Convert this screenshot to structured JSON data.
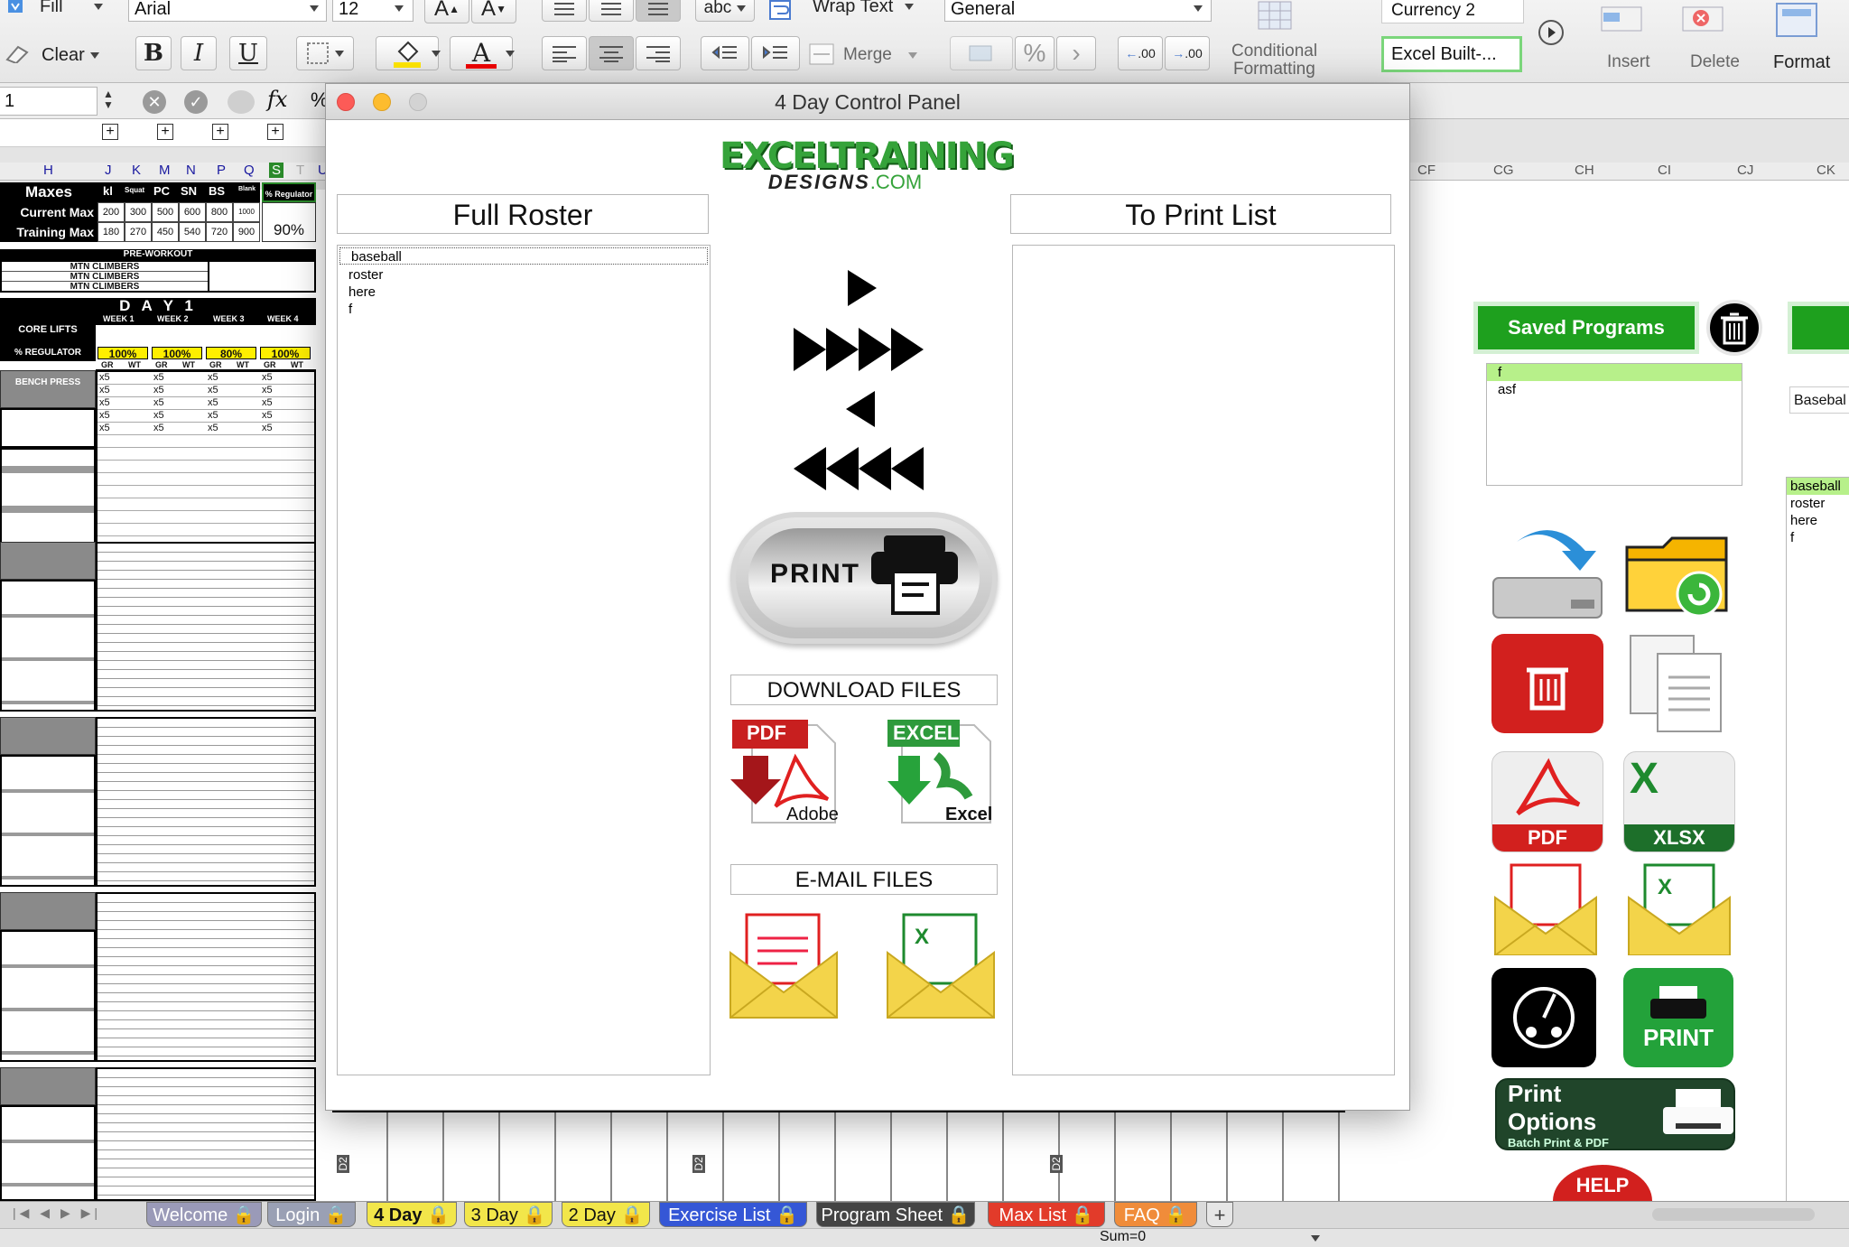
{
  "ribbon": {
    "fill_label": "Fill",
    "clear_label": "Clear",
    "font_name": "Arial",
    "font_size": "12",
    "wrap_text_label": "Wrap Text",
    "merge_label": "Merge",
    "number_format": "General",
    "conditional_label_1": "Conditional",
    "conditional_label_2": "Formatting",
    "style_1": "Currency 2",
    "style_2": "Excel Built-...",
    "insert_label": "Insert",
    "delete_label": "Delete",
    "format_label": "Format",
    "abc_label": "abc",
    "bold": "B",
    "italic": "I",
    "underline": "U",
    "font_color_letter": "A",
    "grow_font": "A",
    "shrink_font": "A",
    "percent": "%",
    "decimal_inc": ".00",
    "decimal_dec": ".00"
  },
  "formula_bar": {
    "name_box": "1",
    "fx": "fx",
    "percent_char": "%"
  },
  "sheet": {
    "columns": [
      "H",
      "J",
      "K",
      "M",
      "N",
      "P",
      "Q",
      "S",
      "T",
      "U"
    ],
    "right_columns": [
      "CF",
      "CG",
      "CH",
      "CI",
      "CJ",
      "CK"
    ],
    "maxes_label": "Maxes",
    "current_max_label": "Current Max",
    "training_max_label": "Training Max",
    "lift_headers": [
      "kl",
      "Squat",
      "PC",
      "SN",
      "BS",
      "Blank",
      "% Regulator"
    ],
    "current_values": [
      "200",
      "300",
      "500",
      "600",
      "800",
      "1000"
    ],
    "training_values": [
      "180",
      "270",
      "450",
      "540",
      "720",
      "900"
    ],
    "regulator_value": "90%",
    "preworkout_label": "PRE-WORKOUT",
    "mtn_climbers": [
      "MTN CLIMBERS",
      "MTN CLIMBERS",
      "MTN CLIMBERS"
    ],
    "day_label": "D A Y   1",
    "weeks": [
      "WEEK 1",
      "WEEK 2",
      "WEEK 3",
      "WEEK 4"
    ],
    "core_lifts_label": "CORE LIFTS",
    "pct_regulator_label": "% REGULATOR",
    "week_pcts": [
      "100%",
      "100%",
      "80%",
      "100%"
    ],
    "gr_wt": [
      "GR",
      "WT"
    ],
    "bench_press_label": "BENCH PRESS",
    "rep_mark": "x5",
    "d2_label": "D2"
  },
  "dialog": {
    "title": "4 Day Control Panel",
    "logo_main": "EXCELTRAINING",
    "logo_sub": "DESIGNS",
    "logo_dotcom": ".COM",
    "full_roster_label": "Full Roster",
    "to_print_label": "To Print List",
    "roster_items": [
      "baseball",
      "roster",
      "here",
      "f"
    ],
    "print_label": "PRINT",
    "download_label": "DOWNLOAD FILES",
    "email_label": "E-MAIL FILES",
    "pdf_badge": "PDF",
    "adobe_label": "Adobe",
    "excel_badge": "EXCEL",
    "excel_label": "Excel"
  },
  "right_panel": {
    "saved_programs_label": "Saved Programs",
    "saved_items": [
      "f",
      "asf"
    ],
    "baseball_partial": "Basebal",
    "side_list": [
      "baseball",
      "roster",
      "here",
      "f"
    ],
    "pdf_tile": "PDF",
    "xlsx_tile": "XLSX",
    "print_tile": "PRINT",
    "print_options_title": "Print Options",
    "print_options_sub": "Batch Print & PDF",
    "help_label": "HELP"
  },
  "tabs": [
    {
      "label": "Welcome",
      "color": "#9a9ab8"
    },
    {
      "label": "Login",
      "color": "#9aa0b4"
    },
    {
      "label": "4 Day",
      "color": "#f2e64a"
    },
    {
      "label": "3 Day",
      "color": "#f2e64a"
    },
    {
      "label": "2 Day",
      "color": "#f2e64a"
    },
    {
      "label": "Exercise List",
      "color": "#3557d6"
    },
    {
      "label": "Program Sheet",
      "color": "#444444"
    },
    {
      "label": "Max List",
      "color": "#e23b2a"
    },
    {
      "label": "FAQ",
      "color": "#f08c3a"
    }
  ],
  "status": {
    "sum_label": "Sum=0"
  }
}
